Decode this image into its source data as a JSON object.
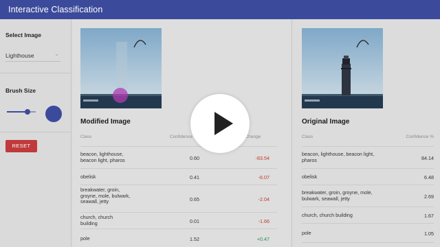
{
  "app": {
    "title": "Interactive Classification"
  },
  "sidebar": {
    "select_image_title": "Select Image",
    "selected_image": "Lighthouse",
    "brush_size_title": "Brush Size",
    "brush_size_fraction": 0.72,
    "reset_label": "RESET"
  },
  "modified": {
    "title": "Modified Image",
    "headers": {
      "class": "Class",
      "confidence": "Confidence %",
      "change": "% Change"
    },
    "rows": [
      {
        "class": "beacon, lighthouse, beacon light, pharos",
        "confidence": "0.60",
        "change": "-83.54",
        "sign": "neg"
      },
      {
        "class": "obelisk",
        "confidence": "0.41",
        "change": "-6.07",
        "sign": "neg"
      },
      {
        "class": "breakwater, groin, groyne, mole, bulwark, seawall, jetty",
        "confidence": "0.65",
        "change": "-2.04",
        "sign": "neg"
      },
      {
        "class": "church, church building",
        "confidence": "0.01",
        "change": "-1.66",
        "sign": "neg"
      },
      {
        "class": "pole",
        "confidence": "1.52",
        "change": "+0.47",
        "sign": "pos"
      }
    ]
  },
  "original": {
    "title": "Original Image",
    "headers": {
      "class": "Class",
      "confidence": "Confidence %"
    },
    "rows": [
      {
        "class": "beacon, lighthouse, beacon light, pharos",
        "confidence": "84.14"
      },
      {
        "class": "obelisk",
        "confidence": "6.48"
      },
      {
        "class": "breakwater, groin, groyne, mole, bulwark, seawall, jetty",
        "confidence": "2.69"
      },
      {
        "class": "church, church building",
        "confidence": "1.67"
      },
      {
        "class": "pole",
        "confidence": "1.05"
      }
    ]
  },
  "colors": {
    "appbar": "#3b4a9b",
    "accent": "#3b4a9b",
    "reset": "#c0393b",
    "negative": "#c0392b",
    "positive": "#2e8b57"
  },
  "icons": {
    "select_caret": "chevron-down-icon",
    "video_overlay": "play-icon"
  }
}
